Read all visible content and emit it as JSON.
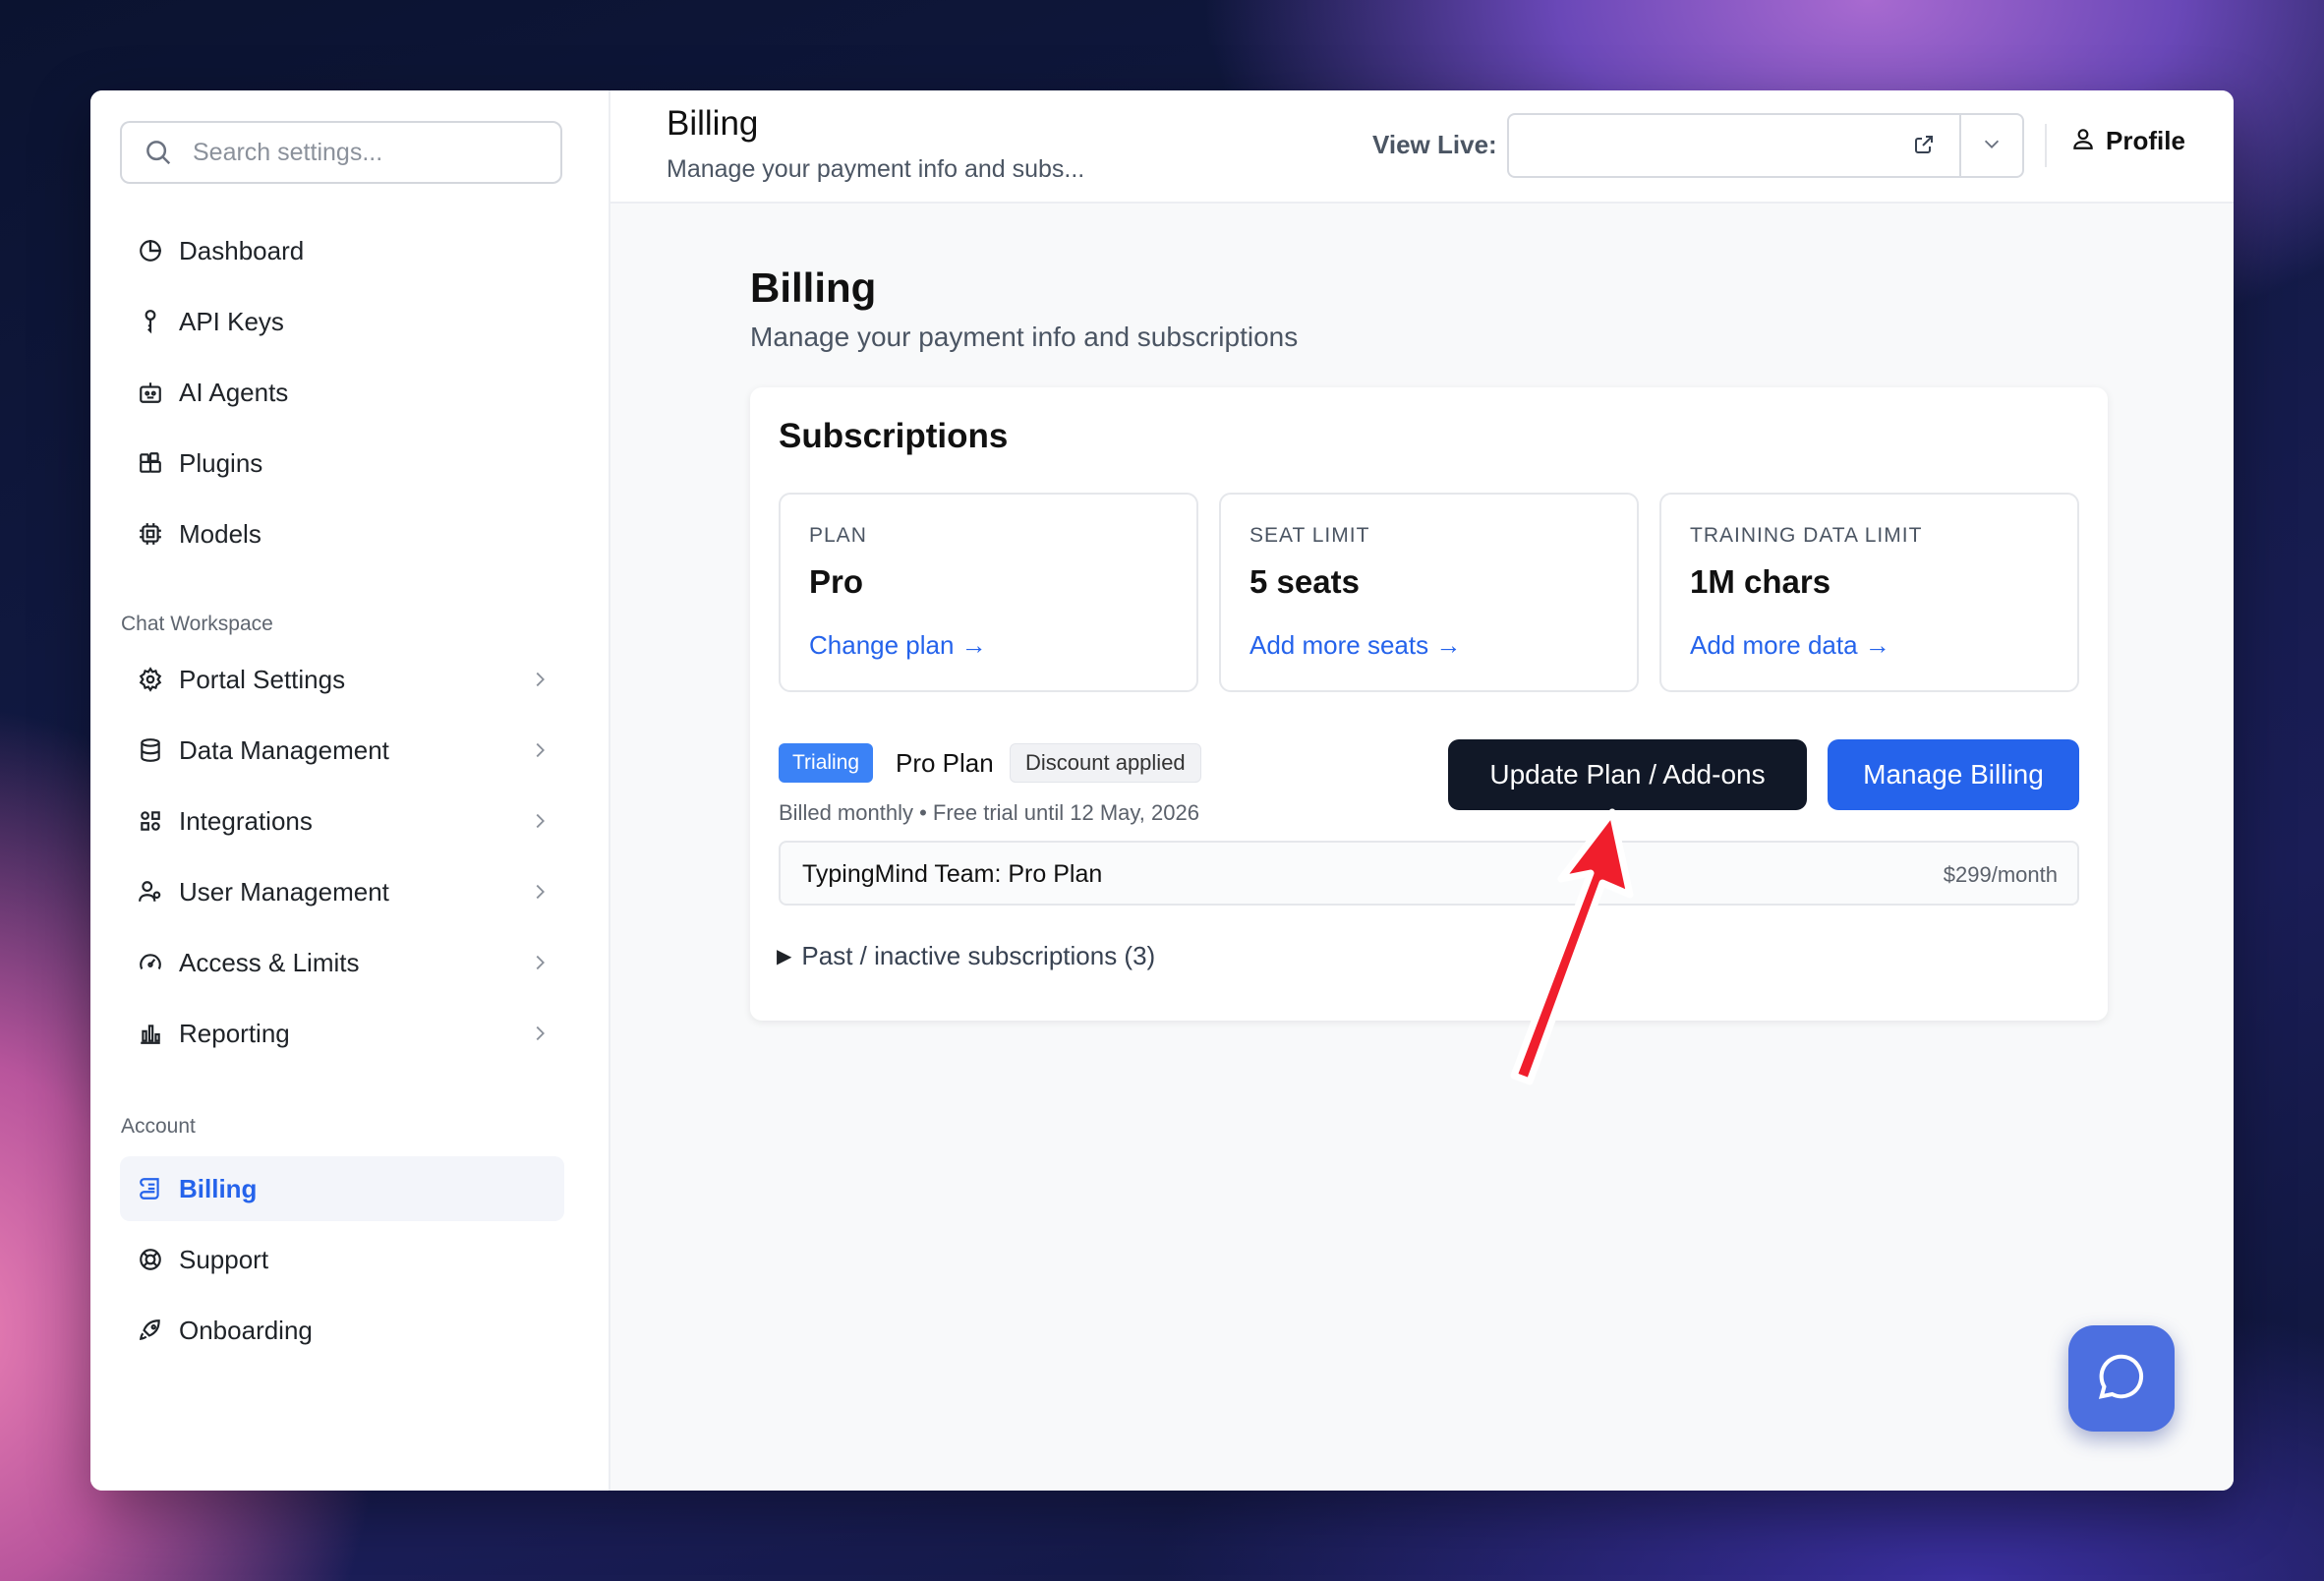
{
  "sidebar": {
    "search_placeholder": "Search settings...",
    "main_items": [
      {
        "label": "Dashboard",
        "icon": "pie-chart-icon"
      },
      {
        "label": "API Keys",
        "icon": "key-icon"
      },
      {
        "label": "AI Agents",
        "icon": "robot-icon"
      },
      {
        "label": "Plugins",
        "icon": "puzzle-icon"
      },
      {
        "label": "Models",
        "icon": "cpu-icon"
      }
    ],
    "workspace_label": "Chat Workspace",
    "workspace_items": [
      {
        "label": "Portal Settings",
        "icon": "gear-icon"
      },
      {
        "label": "Data Management",
        "icon": "database-icon"
      },
      {
        "label": "Integrations",
        "icon": "integrations-icon"
      },
      {
        "label": "User Management",
        "icon": "users-icon"
      },
      {
        "label": "Access & Limits",
        "icon": "gauge-icon"
      },
      {
        "label": "Reporting",
        "icon": "bar-chart-icon"
      }
    ],
    "account_label": "Account",
    "account_items": [
      {
        "label": "Billing",
        "icon": "scroll-icon",
        "active": true
      },
      {
        "label": "Support",
        "icon": "lifebuoy-icon"
      },
      {
        "label": "Onboarding",
        "icon": "rocket-icon"
      }
    ]
  },
  "topbar": {
    "title": "Billing",
    "subtitle": "Manage your payment info and subs...",
    "view_live_label": "View Live:",
    "view_live_value": "",
    "profile_label": "Profile"
  },
  "page": {
    "title": "Billing",
    "subtitle": "Manage your payment info and subscriptions"
  },
  "subscriptions": {
    "title": "Subscriptions",
    "stats": [
      {
        "key": "PLAN",
        "value": "Pro",
        "action": "Change plan →"
      },
      {
        "key": "SEAT LIMIT",
        "value": "5 seats",
        "action": "Add more seats →"
      },
      {
        "key": "TRAINING DATA LIMIT",
        "value": "1M chars",
        "action": "Add more data →"
      }
    ],
    "status_badge": "Trialing",
    "plan_name": "Pro Plan",
    "discount_badge": "Discount applied",
    "billing_info": "Billed monthly • Free trial until 12 May, 2026",
    "update_button": "Update Plan / Add-ons",
    "manage_button": "Manage Billing",
    "line_item": {
      "name": "TypingMind Team: Pro Plan",
      "price": "$299/month"
    },
    "past_label": "Past / inactive subscriptions (3)"
  },
  "colors": {
    "accent": "#2563eb",
    "dark_button": "#111827",
    "badge_blue": "#3b82f6",
    "annotation_arrow": "#f01e2c"
  }
}
